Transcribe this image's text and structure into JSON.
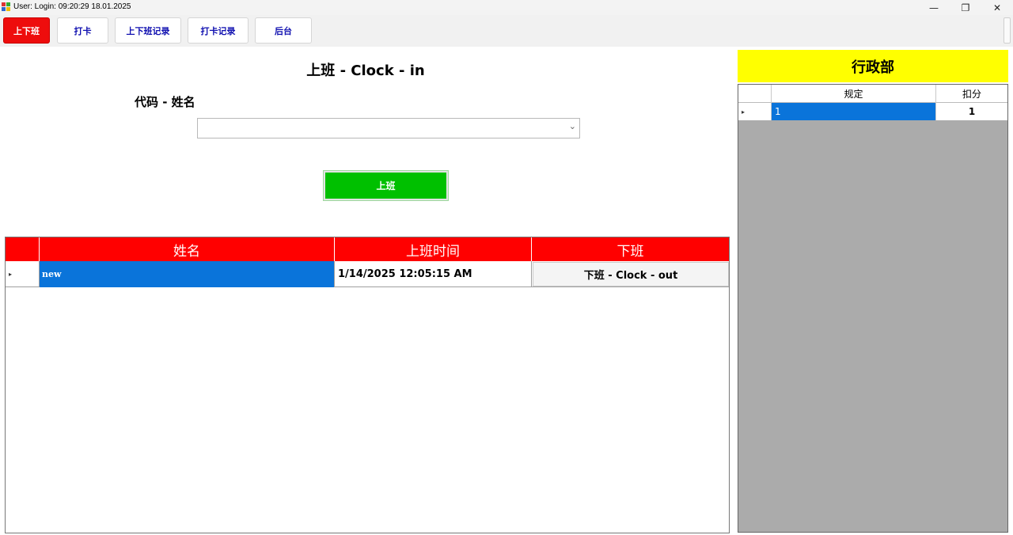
{
  "window": {
    "title": "User:  Login: 09:20:29 18.01.2025",
    "minimize_glyph": "—",
    "restore_glyph": "❐",
    "close_glyph": "✕"
  },
  "toolbar": {
    "buttons": [
      {
        "label": "上下班",
        "active": true
      },
      {
        "label": "打卡",
        "active": false
      },
      {
        "label": "上下班记录",
        "active": false
      },
      {
        "label": "打卡记录",
        "active": false
      },
      {
        "label": "后台",
        "active": false
      }
    ]
  },
  "clock_in": {
    "title": "上班 - Clock - in",
    "field_label": "代码 - 姓名",
    "combo_value": "",
    "chevron": "⌄",
    "button_label": "上班"
  },
  "attendance_grid": {
    "columns": [
      "姓名",
      "上班时间",
      "下班"
    ],
    "rows": [
      {
        "name": "new",
        "clock_in_time": "1/14/2025 12:05:15 AM",
        "action_label": "下班 - Clock - out"
      }
    ],
    "row_marker": "▸"
  },
  "department": {
    "title": "行政部",
    "columns": [
      "规定",
      "扣分"
    ],
    "rows": [
      {
        "rule": "1",
        "points": "1"
      }
    ],
    "row_marker": "▸"
  },
  "colors": {
    "active_tab": "#ee0d0d",
    "clock_button": "#00c000",
    "grid_header": "#ff0000",
    "selection": "#0a74da",
    "department_header": "#ffff00",
    "side_grid_bg": "#ababab"
  }
}
